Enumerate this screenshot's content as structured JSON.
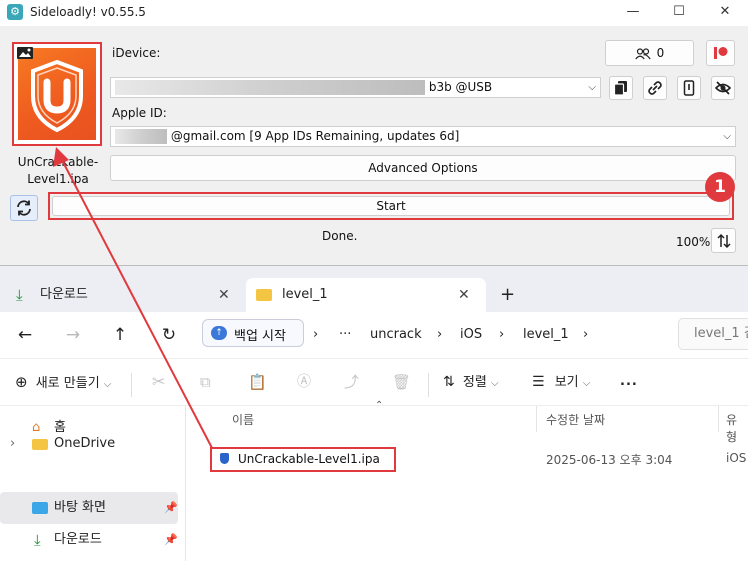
{
  "sideloadly": {
    "title": "Sideloadly! v0.55.5",
    "ipa_filename": "UnCrackable-Level1.ipa",
    "idevice_label": "iDevice:",
    "idevice_value": "b3b @USB",
    "apple_id_label": "Apple ID:",
    "apple_id_value": "@gmail.com [9 App IDs Remaining, updates 6d]",
    "device_count": "0",
    "advanced_label": "Advanced Options",
    "start_label": "Start",
    "status": "Done.",
    "zoom": "100%",
    "annotation_number": "1"
  },
  "explorer": {
    "tabs": [
      {
        "label": "다운로드",
        "active": false
      },
      {
        "label": "level_1",
        "active": true
      }
    ],
    "new_tab": "+",
    "backup_label": "백업 시작",
    "breadcrumb": [
      "uncrack",
      "iOS",
      "level_1"
    ],
    "search_placeholder": "level_1 검",
    "toolbar": {
      "new_label": "새로 만들기",
      "sort_label": "정렬",
      "view_label": "보기",
      "more": "..."
    },
    "nav": [
      {
        "label": "홈"
      },
      {
        "label": "OneDrive"
      },
      {
        "label": "바탕 화면",
        "selected": true
      },
      {
        "label": "다운로드"
      }
    ],
    "columns": {
      "name": "이름",
      "modified": "수정한 날짜",
      "type": "유형"
    },
    "files": [
      {
        "name": "UnCrackable-Level1.ipa",
        "modified": "2025-06-13 오후 3:04",
        "type": "iOS"
      }
    ]
  },
  "colors": {
    "highlight_red": "#e0393e",
    "ipa_orange": "#f36b21",
    "explorer_tab_bg": "#eceef3"
  }
}
